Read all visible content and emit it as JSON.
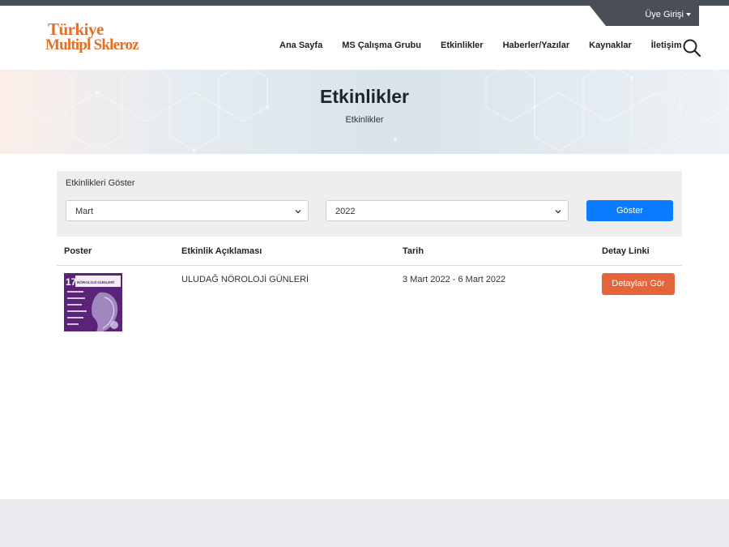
{
  "header": {
    "member_label": "Üye Girişi",
    "logo_line1": "Türkiye",
    "logo_line2": "Multipl Skleroz",
    "nav": [
      "Ana Sayfa",
      "MS Çalışma Grubu",
      "Etkinlikler",
      "Haberler/Yazılar",
      "Kaynaklar",
      "İletişim"
    ]
  },
  "hero": {
    "title": "Etkinlikler",
    "breadcrumb": "Etkinlikler"
  },
  "filter": {
    "label": "Etkinlikleri Göster",
    "month_value": "Mart",
    "year_value": "2022",
    "show_button": "Göster"
  },
  "table": {
    "headers": [
      "Poster",
      "Etkinlik Açıklaması",
      "Tarih",
      "Detay Linki"
    ],
    "rows": [
      {
        "poster_number": "17.",
        "poster_title": "NÖROLOJİ GÜNLERİ",
        "description": "ULUDAĞ NÖROLOJİ GÜNLERİ",
        "date": "3 Mart 2022 - 6 Mart 2022",
        "detail_button": "Detayları Gör"
      }
    ]
  },
  "colors": {
    "brand": "#e0702a",
    "primary_button": "#0b7bff",
    "detail_button": "#e4653a",
    "topbar": "#4a4e57"
  }
}
